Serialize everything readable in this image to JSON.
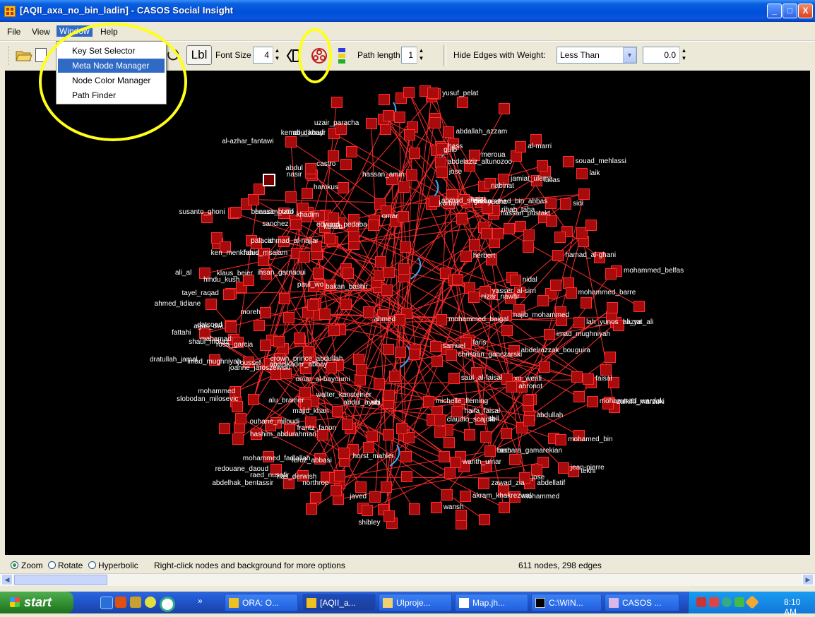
{
  "window": {
    "title": "[AQII_axa_no_bin_ladin] - CASOS Social Insight",
    "controls": {
      "minimize": "_",
      "maximize": "□",
      "close": "X"
    }
  },
  "menubar": {
    "items": [
      "File",
      "View",
      "Window",
      "Help"
    ]
  },
  "window_menu": {
    "items": [
      "Key Set Selector",
      "Meta Node Manager",
      "Node Color Manager",
      "Path Finder"
    ],
    "selected": "Meta Node Manager"
  },
  "toolbar": {
    "label_button": "Lbl",
    "font_size_label": "Font Size",
    "font_size_value": "4",
    "path_length_label": "Path length",
    "path_length_value": "1",
    "hide_edges_label": "Hide Edges with Weight:",
    "comparison_value": "Less Than",
    "weight_value": "0.0"
  },
  "graph": {
    "labels": [
      "ali_yo",
      "abu_khayr",
      "hassan_tarif",
      "ani",
      "mohammed_bin_abbas",
      "barbara_gamarekian",
      "mohammed_fadlallah",
      "paul_wo",
      "dratullah_jamal",
      "ahmad_al-najjar",
      "hass",
      "alu_bramer",
      "ken_menkhaus",
      "imad_mughniyah",
      "mohammed_belfas",
      "abdelkader_abbay",
      "castro",
      "mohammad_wardak",
      "tayel_raqad",
      "xu_wenli",
      "northrop",
      "nizar_nawar",
      "al-marri",
      "zulkifli_marzuki",
      "hindu_kush",
      "meroua",
      "omar_al-bayoumi",
      "nabinat",
      "moreh",
      "mahamad",
      "hamad_al-ghani",
      "shaul_mofaz",
      "laik",
      "lucas",
      "lah_yunos",
      "herbert",
      "nas_derwish",
      "slobodan_milosevic",
      "tekhi",
      "yasser_al-sirri",
      "kataib",
      "rosa_garcia",
      "mohamed_bin",
      "hassan_pustakt",
      "sbil",
      "gulb",
      "al-azhar_fantawi",
      "datsood",
      "abdallah_azzam",
      "uzair_paracha",
      "fahid_msalam",
      "abdullah",
      "hashim_abdurahman",
      "mohammed",
      "frantz_fanon",
      "nasir",
      "mohammed_baigal",
      "abdelaziz_altunozoo",
      "akram_khakrezwal",
      "susanto_ghoni",
      "najib_mohammed",
      "ahronot",
      "majid_khan",
      "yudha",
      "fattahi",
      "bakan_bashir",
      "khadim",
      "mohammed_barre",
      "faisal",
      "nidal",
      "abdellatif",
      "samuel",
      "faris",
      "jamiat_ulema",
      "wanth_umar",
      "ahmed",
      "wansh",
      "abdul",
      "azizi",
      "jose",
      "souad_mehlassi",
      "horst_mahler",
      "jose",
      "mohammed",
      "ouhane_miloudi",
      "raed_nusafir",
      "rihab_taha",
      "korbut",
      "abdelhak_bentassir",
      "ahmed_tidiane",
      "ihsan_garnaoui",
      "shibley",
      "youssef",
      "sanchez",
      "yusuf_pelat",
      "claudio_scajola",
      "redouane_daoud",
      "walter_kansteiner",
      "agus_dwi",
      "feroz_abbasi",
      "javed",
      "christian_ganczarski",
      "palacio",
      "omar",
      "ahmad_shakir",
      "klaus_beier",
      "michelle_fleming",
      "hassan_amin",
      "jean-pierre",
      "haifa_faisal",
      "zawad_zia",
      "joanne_jaroszewski",
      "sidi",
      "edward_pedaba",
      "crown_prince_abdullah",
      "abdelrazzak_bouguira",
      "hamkus",
      "ali_al",
      "imad_mughniyah",
      "saul_al-faisal",
      "hazrat_ali",
      "kemal_daoudi",
      "benazir_butto",
      "abdul_ayub",
      "gissin",
      "raan"
    ]
  },
  "status": {
    "modes": [
      "Zoom",
      "Rotate",
      "Hyperbolic"
    ],
    "selected_mode": "Zoom",
    "hint": "Right-click nodes and background for more options",
    "counts": "611 nodes, 298 edges"
  },
  "taskbar": {
    "start_label": "start",
    "tasks": [
      "ORA: O...",
      "[AQII_a...",
      "UIproje...",
      "Map.jh...",
      "C:\\WIN...",
      "CASOS ..."
    ],
    "active_task": "[AQII_a...",
    "clock": "8:10 AM"
  }
}
